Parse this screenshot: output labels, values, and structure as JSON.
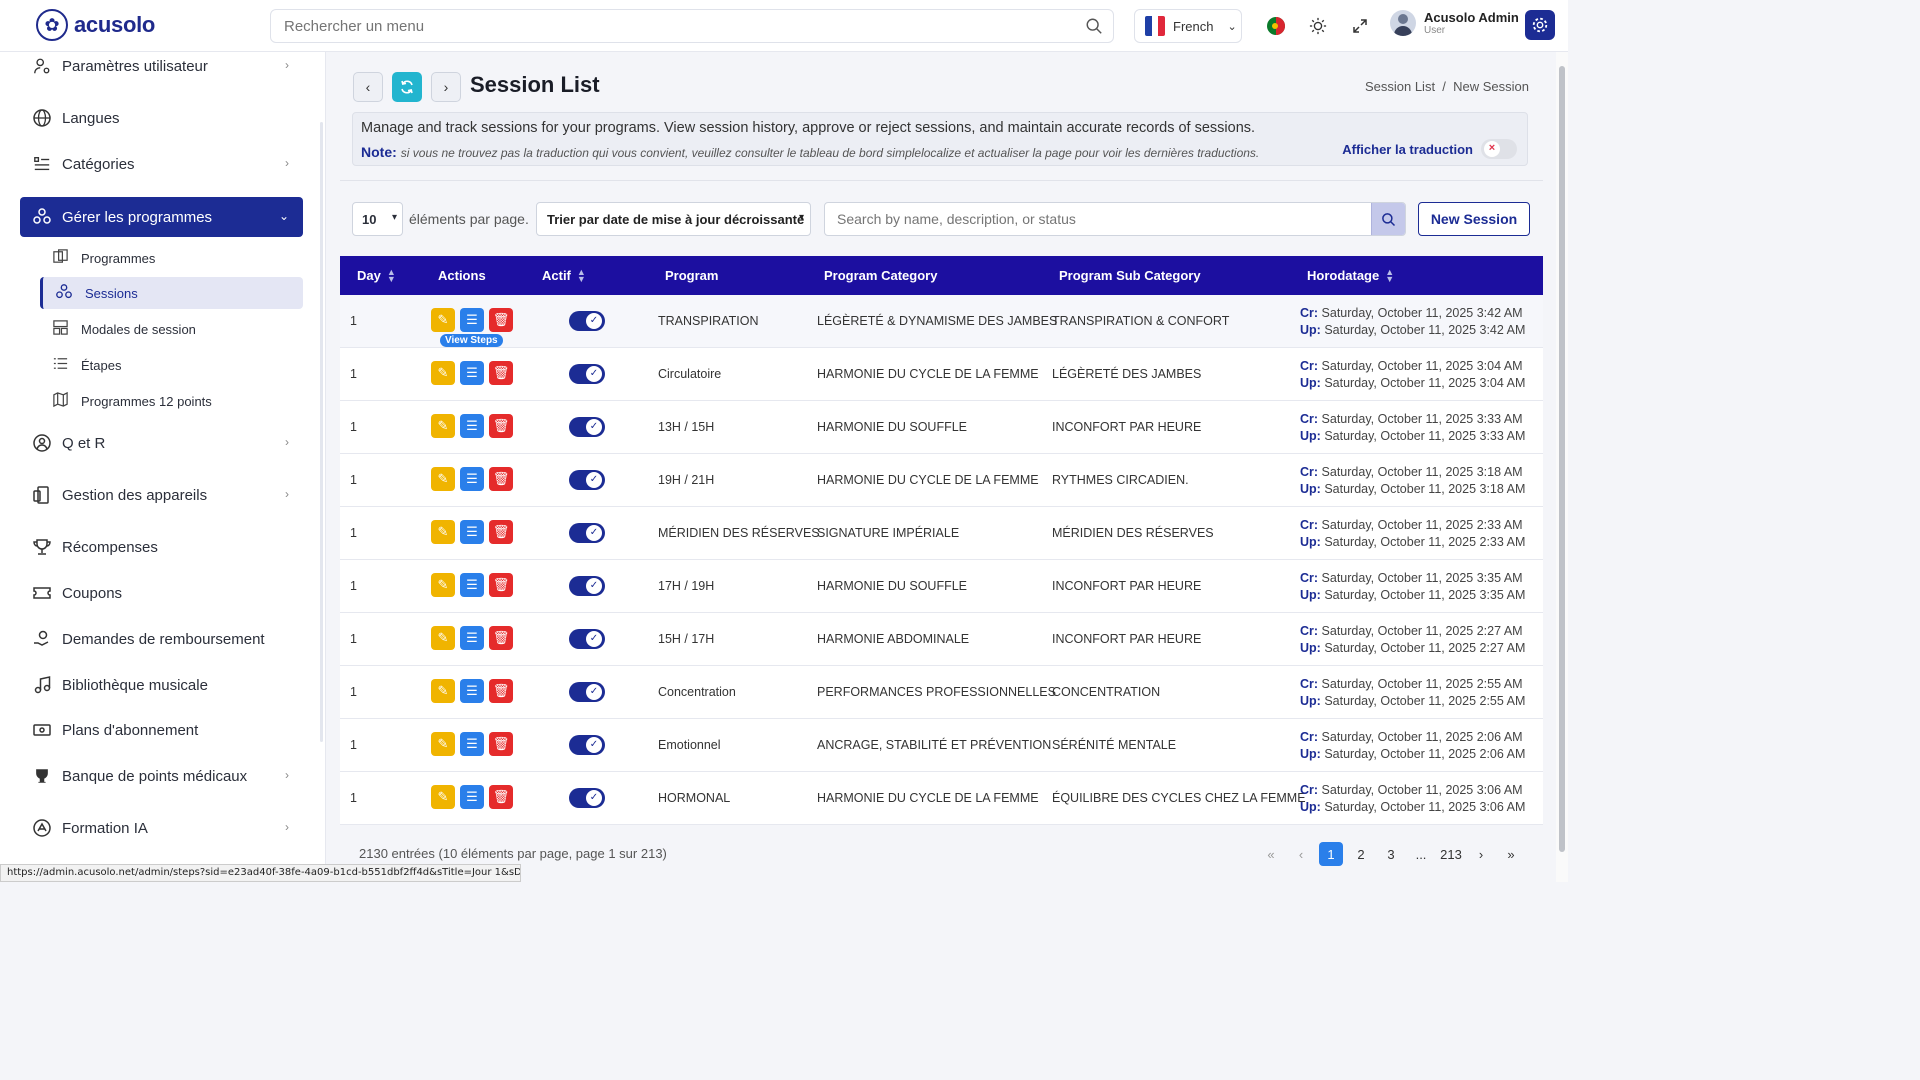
{
  "brand": {
    "name": "acusolo"
  },
  "topbar": {
    "search_placeholder": "Rechercher un menu",
    "language": "French",
    "user_name": "Acusolo Admin",
    "user_role": "User"
  },
  "sidebar": {
    "items": [
      {
        "label": "Paramètres utilisateur",
        "icon": "user-settings-icon"
      },
      {
        "label": "Langues",
        "icon": "globe-icon"
      },
      {
        "label": "Catégories",
        "icon": "list-icon"
      },
      {
        "label": "Gérer les programmes",
        "icon": "programs-icon"
      },
      {
        "label": "Q et R",
        "icon": "qa-icon"
      },
      {
        "label": "Gestion des appareils",
        "icon": "devices-icon"
      },
      {
        "label": "Récompenses",
        "icon": "trophy-icon"
      },
      {
        "label": "Coupons",
        "icon": "ticket-icon"
      },
      {
        "label": "Demandes de remboursement",
        "icon": "refund-icon"
      },
      {
        "label": "Bibliothèque musicale",
        "icon": "music-icon"
      },
      {
        "label": "Plans d'abonnement",
        "icon": "subscription-icon"
      },
      {
        "label": "Banque de points médicaux",
        "icon": "medical-icon"
      },
      {
        "label": "Formation IA",
        "icon": "ai-icon"
      }
    ],
    "subitems": [
      {
        "label": "Programmes"
      },
      {
        "label": "Sessions"
      },
      {
        "label": "Modales de session"
      },
      {
        "label": "Étapes"
      },
      {
        "label": "Programmes 12 points"
      }
    ]
  },
  "page": {
    "title": "Session List",
    "breadcrumb": "Session List  /  New Session",
    "description": "Manage and track sessions for your programs. View session history, approve or reject sessions, and maintain accurate records of sessions.",
    "note_label": "Note:",
    "note_text": "si vous ne trouvez pas la traduction qui vous convient, veuillez consulter le tableau de bord simplelocalize et actualiser la page pour voir les dernières traductions.",
    "translation_toggle": "Afficher la traduction"
  },
  "controls": {
    "per_page": "10",
    "per_page_label": "éléments par page.",
    "sort": "Trier par date de mise à jour décroissante",
    "search_placeholder": "Search by name, description, or status",
    "new_button": "New Session"
  },
  "table": {
    "headers": {
      "day": "Day",
      "actions": "Actions",
      "active": "Actif",
      "program": "Program",
      "category": "Program Category",
      "subcategory": "Program Sub Category",
      "timestamp": "Horodatage"
    },
    "tooltip": "View Steps",
    "cr_label": "Cr:",
    "up_label": "Up:",
    "rows": [
      {
        "day": "1",
        "program": "TRANSPIRATION",
        "category": "LÉGÈRETÉ & DYNAMISME DES JAMBES",
        "subcategory": "TRANSPIRATION & CONFORT",
        "cr": "Saturday, October 11, 2025 3:42 AM",
        "up": "Saturday, October 11, 2025 3:42 AM"
      },
      {
        "day": "1",
        "program": "Circulatoire",
        "category": "HARMONIE DU CYCLE DE LA FEMME",
        "subcategory": "LÉGÈRETÉ DES JAMBES",
        "cr": "Saturday, October 11, 2025 3:04 AM",
        "up": "Saturday, October 11, 2025 3:04 AM"
      },
      {
        "day": "1",
        "program": "13H / 15H",
        "category": "HARMONIE DU SOUFFLE",
        "subcategory": "INCONFORT PAR HEURE",
        "cr": "Saturday, October 11, 2025 3:33 AM",
        "up": "Saturday, October 11, 2025 3:33 AM"
      },
      {
        "day": "1",
        "program": "19H / 21H",
        "category": "HARMONIE DU CYCLE DE LA FEMME",
        "subcategory": "RYTHMES CIRCADIEN.",
        "cr": "Saturday, October 11, 2025 3:18 AM",
        "up": "Saturday, October 11, 2025 3:18 AM"
      },
      {
        "day": "1",
        "program": "MÉRIDIEN DES RÉSERVES",
        "category": "SIGNATURE IMPÉRIALE",
        "subcategory": "MÉRIDIEN DES RÉSERVES",
        "cr": "Saturday, October 11, 2025 2:33 AM",
        "up": "Saturday, October 11, 2025 2:33 AM"
      },
      {
        "day": "1",
        "program": "17H / 19H",
        "category": "HARMONIE DU SOUFFLE",
        "subcategory": "INCONFORT PAR HEURE",
        "cr": "Saturday, October 11, 2025 3:35 AM",
        "up": "Saturday, October 11, 2025 3:35 AM"
      },
      {
        "day": "1",
        "program": "15H / 17H",
        "category": "HARMONIE ABDOMINALE",
        "subcategory": "INCONFORT PAR HEURE",
        "cr": "Saturday, October 11, 2025 2:27 AM",
        "up": "Saturday, October 11, 2025 2:27 AM"
      },
      {
        "day": "1",
        "program": "Concentration",
        "category": "PERFORMANCES PROFESSIONNELLES",
        "subcategory": "CONCENTRATION",
        "cr": "Saturday, October 11, 2025 2:55 AM",
        "up": "Saturday, October 11, 2025 2:55 AM"
      },
      {
        "day": "1",
        "program": "Emotionnel",
        "category": "ANCRAGE, STABILITÉ ET PRÉVENTION",
        "subcategory": "SÉRÉNITÉ MENTALE",
        "cr": "Saturday, October 11, 2025 2:06 AM",
        "up": "Saturday, October 11, 2025 2:06 AM"
      },
      {
        "day": "1",
        "program": "HORMONAL",
        "category": "HARMONIE DU CYCLE DE LA FEMME",
        "subcategory": "ÉQUILIBRE DES CYCLES CHEZ LA FEMME",
        "cr": "Saturday, October 11, 2025 3:06 AM",
        "up": "Saturday, October 11, 2025 3:06 AM"
      }
    ]
  },
  "footer": {
    "entries": "2130 entrées (10 éléments par page, page 1 sur 213)",
    "pages": [
      "1",
      "2",
      "3",
      "...",
      "213"
    ]
  },
  "status_url": "https://admin.acusolo.net/admin/steps?sid=e23ad40f-38fe-4a09-b1cd-b551dbf2ff4d&sTitle=Jour 1&sDay=17d69b9...",
  "colors": {
    "primary": "#1c2c94",
    "header": "#1c0fa0",
    "edit": "#f0b400",
    "steps": "#2a7fea",
    "delete": "#e52b2b",
    "refresh": "#22b5cf"
  }
}
